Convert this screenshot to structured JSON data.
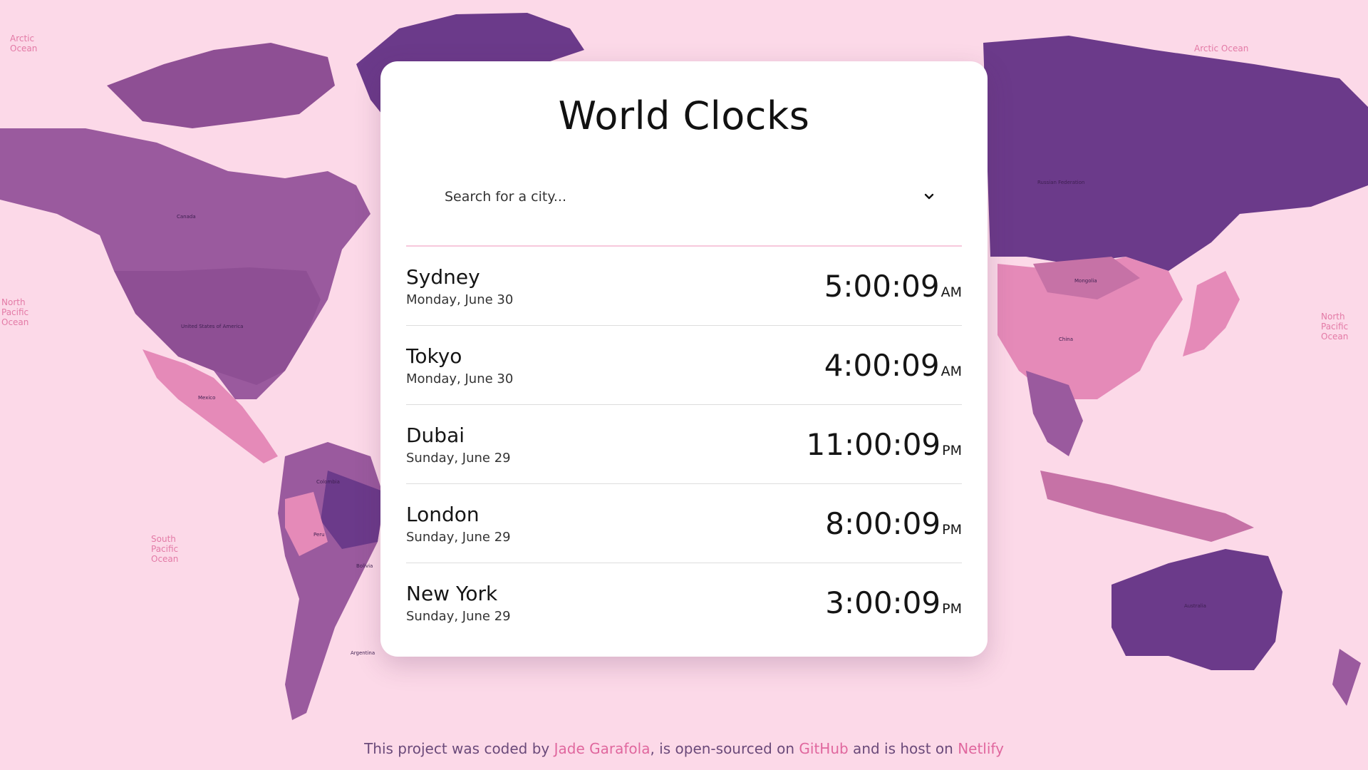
{
  "header": {
    "title": "World Clocks"
  },
  "search": {
    "placeholder": "Search for a city..."
  },
  "cities": [
    {
      "name": "Sydney",
      "date": "Monday, June 30",
      "time": "5:00:09",
      "ampm": "AM"
    },
    {
      "name": "Tokyo",
      "date": "Monday, June 30",
      "time": "4:00:09",
      "ampm": "AM"
    },
    {
      "name": "Dubai",
      "date": "Sunday, June 29",
      "time": "11:00:09",
      "ampm": "PM"
    },
    {
      "name": "London",
      "date": "Sunday, June 29",
      "time": "8:00:09",
      "ampm": "PM"
    },
    {
      "name": "New York",
      "date": "Sunday, June 29",
      "time": "3:00:09",
      "ampm": "PM"
    }
  ],
  "footer": {
    "t1": "This project was coded by ",
    "author": "Jade Garafola",
    "t2": ", is open-sourced on ",
    "github": "GitHub",
    "t3": " and is host on ",
    "netlify": "Netlify"
  },
  "map": {
    "oceans": [
      {
        "id": "arctic-w",
        "lines": [
          "Arctic",
          "Ocean"
        ]
      },
      {
        "id": "arctic-e",
        "lines": [
          "Arctic Ocean"
        ]
      },
      {
        "id": "npac-w",
        "lines": [
          "North",
          "Pacific",
          "Ocean"
        ]
      },
      {
        "id": "npac-e",
        "lines": [
          "North",
          "Pacific",
          "Ocean"
        ]
      },
      {
        "id": "spac",
        "lines": [
          "South",
          "Pacific",
          "Ocean"
        ]
      }
    ],
    "countries": [
      "Canada",
      "United States of America",
      "Mexico",
      "Colombia",
      "Peru",
      "Bolivia",
      "Argentina",
      "Russian Federation",
      "Mongolia",
      "China",
      "Australia"
    ]
  },
  "colors": {
    "background": "#fcd9e8",
    "land_dark": "#6b3a8a",
    "land_mid": "#9a5a9e",
    "land_pink": "#e58ab8",
    "accent_link": "#e0679e"
  }
}
